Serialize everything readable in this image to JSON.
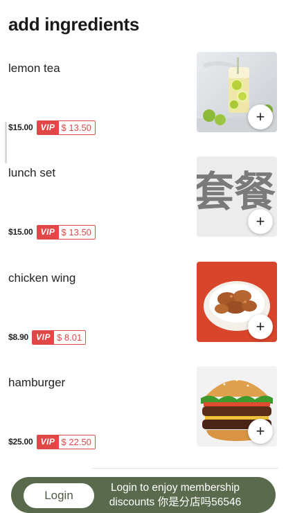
{
  "page": {
    "title": "add ingredients"
  },
  "vip_label": "VIP",
  "items": [
    {
      "name": "lemon tea",
      "price": "$15.00",
      "vip_currency": "$",
      "vip_price": "13.50",
      "image": "lemon-tea-photo"
    },
    {
      "name": "lunch set",
      "price": "$15.00",
      "vip_currency": "$",
      "vip_price": "13.50",
      "image": "lunch-set-calligraphy",
      "image_text": "套餐"
    },
    {
      "name": "chicken wing",
      "price": "$8.90",
      "vip_currency": "$",
      "vip_price": "8.01",
      "image": "chicken-wing-photo"
    },
    {
      "name": "hamburger",
      "price": "$25.00",
      "vip_currency": "$",
      "vip_price": "22.50",
      "image": "hamburger-photo"
    }
  ],
  "add_button_symbol": "+",
  "login_bar": {
    "button_label": "Login",
    "line1": "Login to enjoy membership",
    "line2": "discounts 你是分店吗56546"
  },
  "colors": {
    "vip_red": "#e04848",
    "login_bar_bg": "#5a6b4d"
  }
}
